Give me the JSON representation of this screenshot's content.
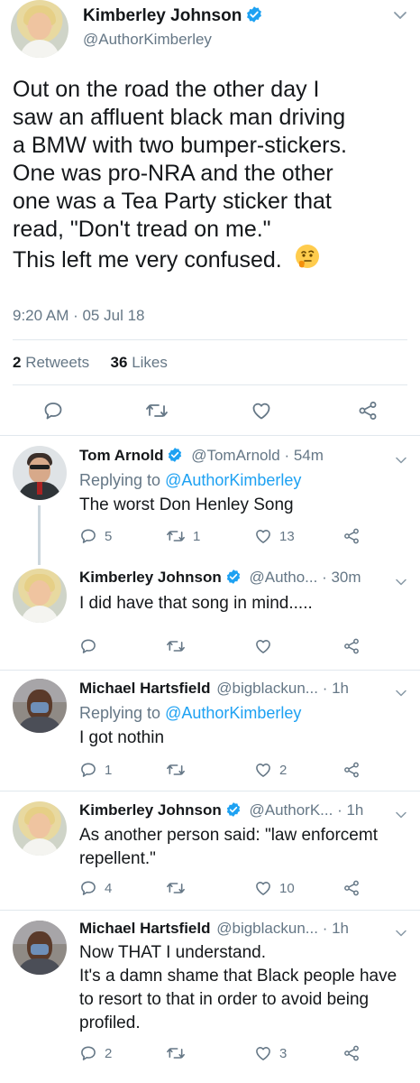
{
  "main": {
    "name": "Kimberley Johnson",
    "handle": "@AuthorKimberley",
    "text_lines": [
      "Out on the road the other day I",
      "saw an affluent black man driving",
      "a BMW with two bumper-stickers.",
      "One was pro-NRA and the other",
      "one was a Tea Party sticker that",
      "read, \"Don't tread on me.\"",
      "This left me very confused."
    ],
    "emoji": "thinking-face",
    "timestamp": "9:20 AM · 05 Jul 18",
    "retweets_count": "2",
    "retweets_label": "Retweets",
    "likes_count": "36",
    "likes_label": "Likes"
  },
  "replies": [
    {
      "name": "Tom Arnold",
      "handle": "@TomArnold",
      "time": "· 54m",
      "replying_prefix": "Replying to",
      "replying_to": "@AuthorKimberley",
      "text_lines": [
        "The worst Don Henley Song"
      ],
      "reply_count": "5",
      "retweet_count": "1",
      "like_count": "13"
    },
    {
      "name": "Kimberley Johnson",
      "handle": "@Autho...",
      "time": "· 30m",
      "text_lines": [
        "I did have that song in mind....."
      ],
      "reply_count": "",
      "retweet_count": "",
      "like_count": ""
    },
    {
      "name": "Michael Hartsfield",
      "handle": "@bigblackun...",
      "time": "· 1h",
      "replying_prefix": "Replying to",
      "replying_to": "@AuthorKimberley",
      "text_lines": [
        "I got nothin"
      ],
      "reply_count": "1",
      "retweet_count": "",
      "like_count": "2"
    },
    {
      "name": "Kimberley Johnson",
      "handle": "@AuthorK...",
      "time": "· 1h",
      "text_lines": [
        "As another person said: \"law enforcemt",
        "repellent.\""
      ],
      "reply_count": "4",
      "retweet_count": "",
      "like_count": "10"
    },
    {
      "name": "Michael Hartsfield",
      "handle": "@bigblackun...",
      "time": "· 1h",
      "text_lines": [
        "Now THAT I understand.",
        "It's a damn shame that Black people have",
        "to resort to that in order to avoid being",
        "profiled."
      ],
      "reply_count": "2",
      "retweet_count": "",
      "like_count": "3"
    }
  ],
  "colors": {
    "verified": "#1da1f2",
    "link": "#1da1f2",
    "muted": "#657786",
    "divider": "#e1e8ed"
  }
}
